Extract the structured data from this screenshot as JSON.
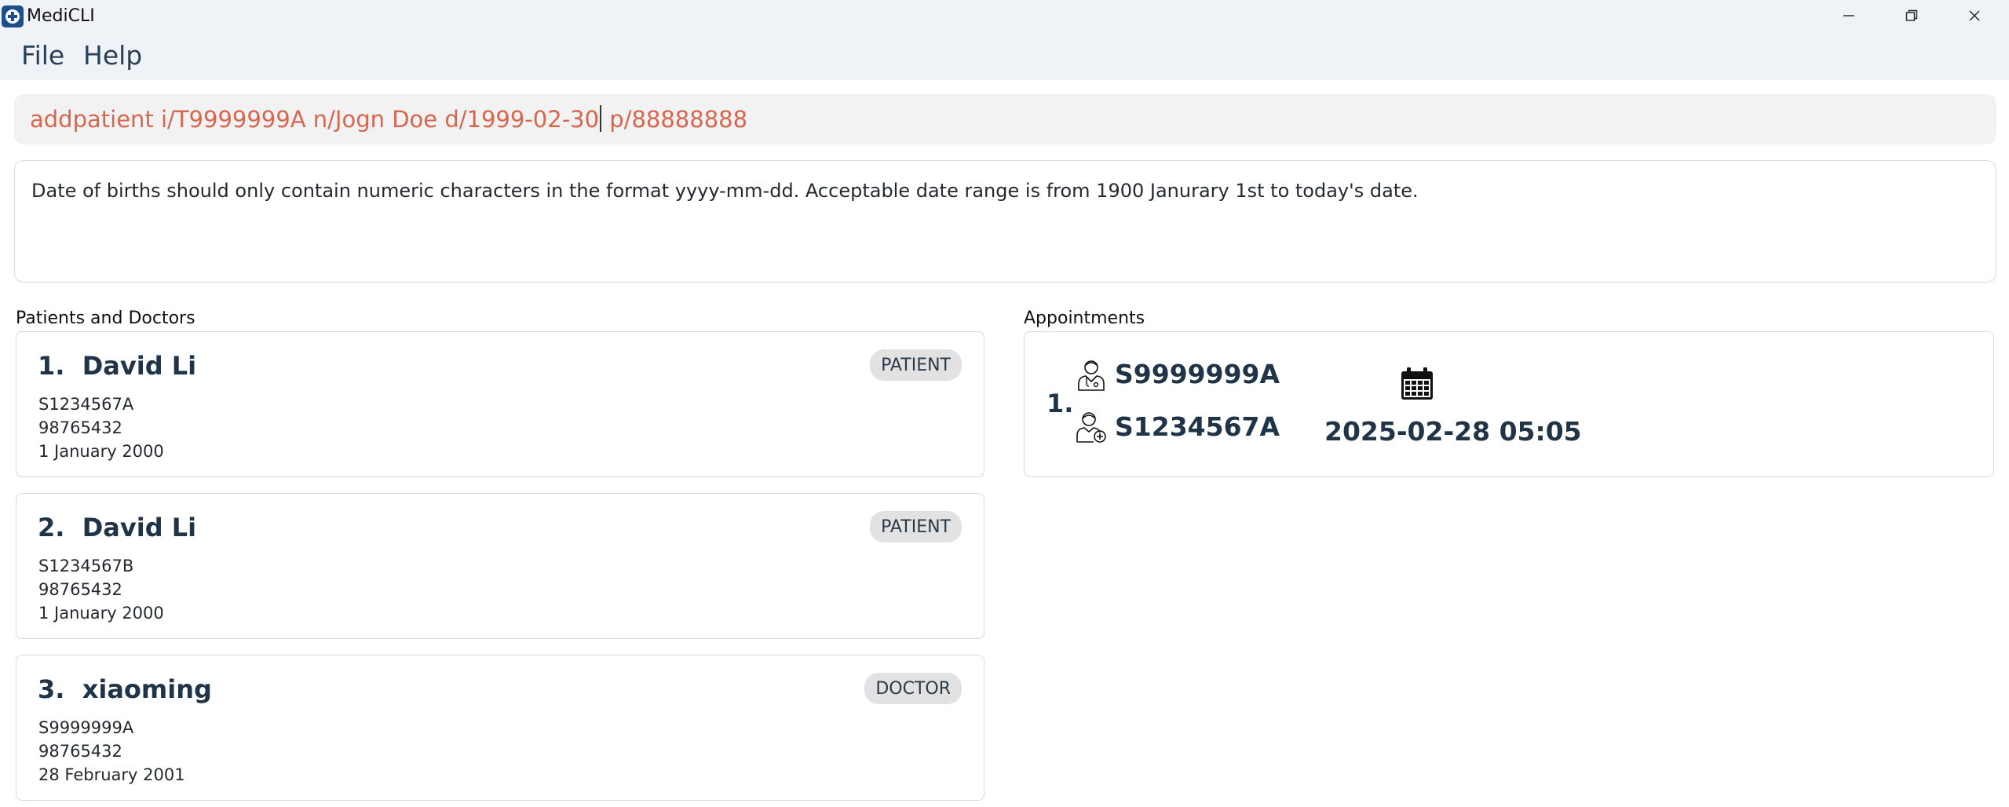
{
  "window": {
    "title": "MediCLI",
    "minimize_icon": "minimize-icon",
    "maximize_icon": "restore-icon",
    "close_icon": "close-icon"
  },
  "menu": {
    "items": [
      "File",
      "Help"
    ]
  },
  "command": {
    "value_before_caret": "addpatient i/T9999999A n/Jogn Doe d/1999-02-30",
    "value_after_caret": " p/88888888",
    "text_color": "#d7664f"
  },
  "result": {
    "message": "Date of births should only contain numeric characters in the format yyyy-mm-dd. Acceptable date range is from 1900 Janurary 1st to today's date."
  },
  "people_panel": {
    "label": "Patients and Doctors",
    "cards": [
      {
        "name": "1.  David Li",
        "badge": "PATIENT",
        "nric": "S1234567A",
        "phone": "98765432",
        "dob": "1 January 2000"
      },
      {
        "name": "2.  David Li",
        "badge": "PATIENT",
        "nric": "S1234567B",
        "phone": "98765432",
        "dob": "1 January 2000"
      },
      {
        "name": "3.  xiaoming",
        "badge": "DOCTOR",
        "nric": "S9999999A",
        "phone": "98765432",
        "dob": "28 February 2001"
      }
    ]
  },
  "appointments_panel": {
    "label": "Appointments",
    "items": [
      {
        "index": "1.",
        "doctor_icon": "doctor-icon",
        "doctor_id": "S9999999A",
        "patient_icon": "patient-icon",
        "patient_id": "S1234567A",
        "calendar_icon": "calendar-icon",
        "datetime": "2025-02-28 05:05"
      }
    ]
  }
}
